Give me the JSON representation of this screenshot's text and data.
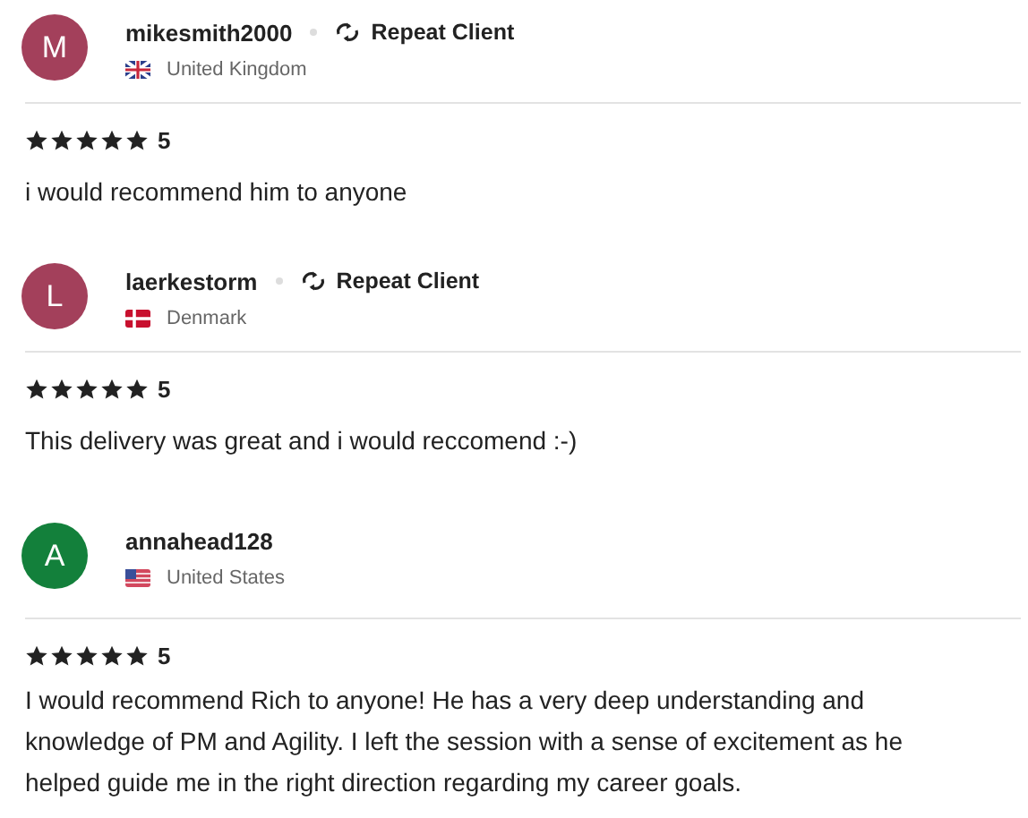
{
  "reviews": [
    {
      "initial": "M",
      "color": "#a3405b",
      "username": "mikesmith2000",
      "badge": "Repeat Client",
      "kind": "uk",
      "country": "United Kingdom",
      "stars": 5,
      "rating": "5",
      "text": "i would recommend him to anyone"
    },
    {
      "initial": "L",
      "color": "#a3405b",
      "username": "laerkestorm",
      "badge": "Repeat Client",
      "kind": "dk",
      "country": "Denmark",
      "stars": 5,
      "rating": "5",
      "text": "This delivery was great and i would reccomend :-)"
    },
    {
      "initial": "A",
      "color": "#13803b",
      "username": "annahead128",
      "kind": "us",
      "country": "United States",
      "stars": 5,
      "rating": "5",
      "text": "I would recommend Rich to anyone! He has a very deep understanding and knowledge of PM and Agility. I left the session with a sense of excitement as he helped guide me in the right direction regarding my career goals."
    }
  ]
}
